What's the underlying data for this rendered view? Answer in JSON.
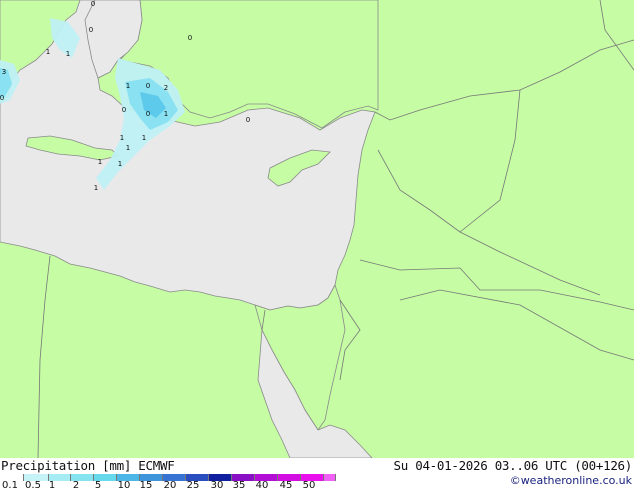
{
  "map": {
    "colors": {
      "land": "#c5fca4",
      "sea": "#e9e9ea",
      "border": "#777777",
      "coast": "#8a8a8a"
    },
    "precip_labels": [
      "0",
      "0",
      "0",
      "1",
      "1",
      "1",
      "2",
      "0",
      "0",
      "0",
      "1",
      "1",
      "1",
      "1",
      "1",
      "1",
      "3",
      "0",
      "1",
      "0"
    ]
  },
  "footer": {
    "title_left": "Precipitation [mm]  ECMWF",
    "title_right": "Su 04-01-2026 03..06 UTC (00+126)",
    "credit": "©weatheronline.co.uk"
  },
  "legend": {
    "ticks": [
      "0.1",
      "0.5",
      "1",
      "2",
      "5",
      "10",
      "15",
      "20",
      "25",
      "30",
      "35",
      "40",
      "45",
      "50"
    ],
    "colors": [
      "#ffffff",
      "#c6f3f8",
      "#a6ecf4",
      "#86e4f0",
      "#66d9ec",
      "#4cb7e6",
      "#3f95dc",
      "#3673d2",
      "#2a4ec0",
      "#0f1f9e",
      "#8a10c6",
      "#b20ed6",
      "#d20ee2",
      "#ea10ee",
      "#f060f4"
    ]
  }
}
